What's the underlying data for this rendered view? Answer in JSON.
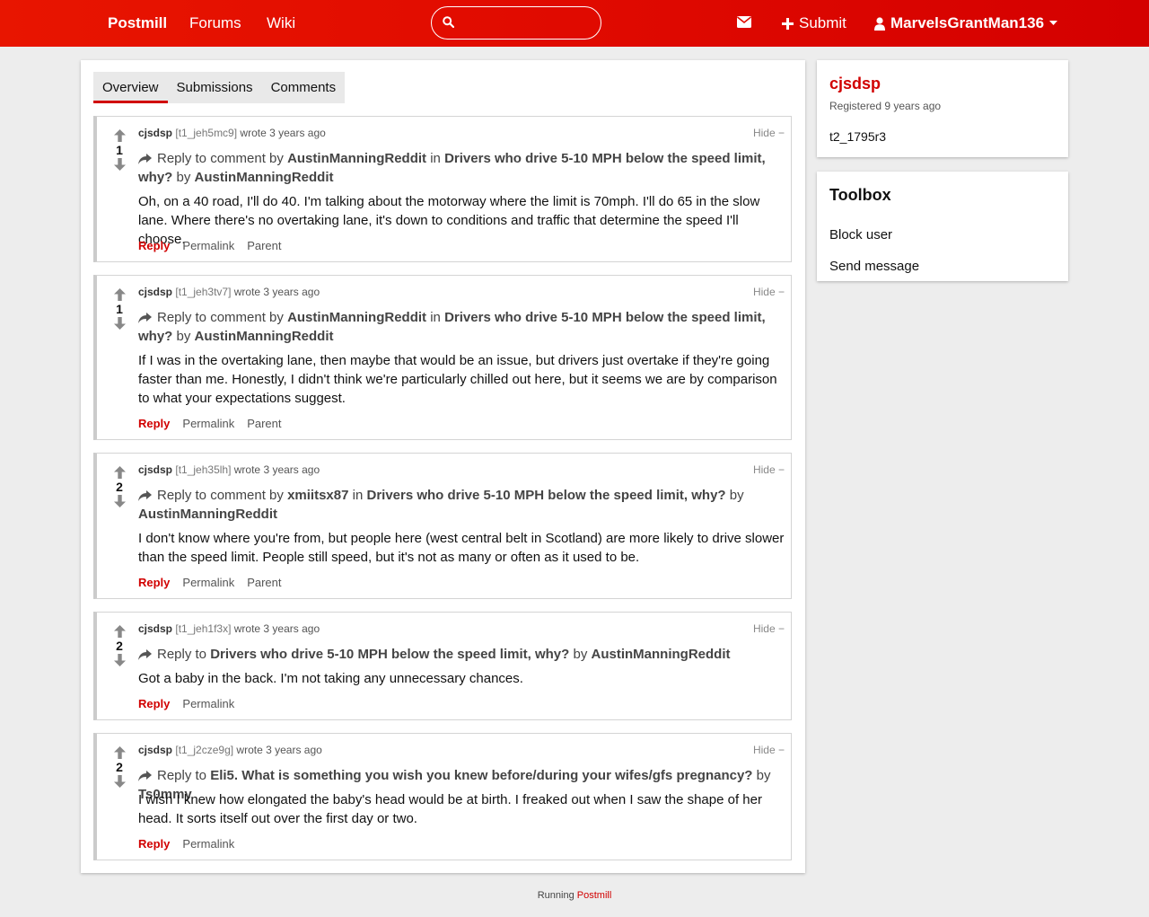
{
  "nav": {
    "brand": "Postmill",
    "links": [
      "Forums",
      "Wiki"
    ],
    "search_value": "",
    "submit_label": "Submit",
    "username": "MarvelsGrantMan136"
  },
  "tabs": [
    "Overview",
    "Submissions",
    "Comments"
  ],
  "comments": [
    {
      "score": "1",
      "author": "cjsdsp",
      "id": "[t1_jeh5mc9]",
      "time": "wrote 3 years ago",
      "hide": "Hide −",
      "ctx_reply": "Reply to comment by",
      "ctx_user": "AustinManningReddit",
      "ctx_in": "in",
      "ctx_title": "Drivers who drive 5-10 MPH below the speed limit, why?",
      "ctx_by": "by",
      "ctx_op": "AustinManningReddit",
      "text": "Oh, on a 40 road, I'll do 40. I'm talking about the motorway where the limit is 70mph. I'll do 65 in the slow lane. Where there's no overtaking lane, it's down to conditions and traffic that determine the speed I'll choose.",
      "reply": "Reply",
      "permalink": "Permalink",
      "parent": "Parent"
    },
    {
      "score": "1",
      "author": "cjsdsp",
      "id": "[t1_jeh3tv7]",
      "time": "wrote 3 years ago",
      "hide": "Hide −",
      "ctx_reply": "Reply to comment by",
      "ctx_user": "AustinManningReddit",
      "ctx_in": "in",
      "ctx_title": "Drivers who drive 5-10 MPH below the speed limit, why?",
      "ctx_by": "by",
      "ctx_op": "AustinManningReddit",
      "text": "If I was in the overtaking lane, then maybe that would be an issue, but drivers just overtake if they're going faster than me. Honestly, I didn't think we're particularly chilled out here, but it seems we are by comparison to what your expectations suggest.",
      "reply": "Reply",
      "permalink": "Permalink",
      "parent": "Parent"
    },
    {
      "score": "2",
      "author": "cjsdsp",
      "id": "[t1_jeh35lh]",
      "time": "wrote 3 years ago",
      "hide": "Hide −",
      "ctx_reply": "Reply to comment by",
      "ctx_user": "xmiitsx87",
      "ctx_in": "in",
      "ctx_title": "Drivers who drive 5-10 MPH below the speed limit, why?",
      "ctx_by": "by",
      "ctx_op": "AustinManningReddit",
      "text": "I don't know where you're from, but people here (west central belt in Scotland) are more likely to drive slower than the speed limit. People still speed, but it's not as many or often as it used to be.",
      "reply": "Reply",
      "permalink": "Permalink",
      "parent": "Parent"
    },
    {
      "score": "2",
      "author": "cjsdsp",
      "id": "[t1_jeh1f3x]",
      "time": "wrote 3 years ago",
      "hide": "Hide −",
      "ctx_reply": "Reply to",
      "ctx_title": "Drivers who drive 5-10 MPH below the speed limit, why?",
      "ctx_by": "by",
      "ctx_op": "AustinManningReddit",
      "text": "Got a baby in the back. I'm not taking any unnecessary chances.",
      "reply": "Reply",
      "permalink": "Permalink"
    },
    {
      "score": "2",
      "author": "cjsdsp",
      "id": "[t1_j2cze9g]",
      "time": "wrote 3 years ago",
      "hide": "Hide −",
      "ctx_reply": "Reply to",
      "ctx_title": "Eli5. What is something you wish you knew before/during your wifes/gfs pregnancy?",
      "ctx_by": "by",
      "ctx_op": "Ts0mmy",
      "text": "I wish I knew how elongated the baby's head would be at birth. I freaked out when I saw the shape of her head. It sorts itself out over the first day or two.",
      "reply": "Reply",
      "permalink": "Permalink"
    }
  ],
  "sidebar": {
    "username": "cjsdsp",
    "registered": "Registered 9 years ago",
    "user_id": "t2_1795r3",
    "toolbox_title": "Toolbox",
    "block_user": "Block user",
    "send_message": "Send message"
  },
  "footer": {
    "running": "Running",
    "link": "Postmill"
  },
  "colors": {
    "brand": "#e00a00",
    "accent": "#d10000"
  }
}
